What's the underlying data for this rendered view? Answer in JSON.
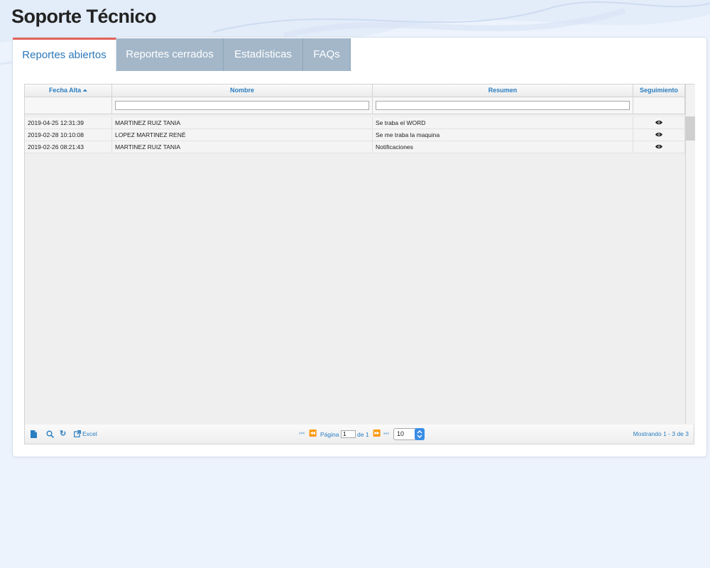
{
  "page": {
    "title": "Soporte Técnico"
  },
  "tabs": [
    {
      "label": "Reportes abiertos",
      "active": true
    },
    {
      "label": "Reportes cerrados",
      "active": false
    },
    {
      "label": "Estadísticas",
      "active": false
    },
    {
      "label": "FAQs",
      "active": false
    }
  ],
  "grid": {
    "columns": {
      "fecha": "Fecha Alta",
      "nombre": "Nombre",
      "resumen": "Resumen",
      "seguimiento": "Seguimiento"
    },
    "filters": {
      "nombre": "",
      "resumen": ""
    },
    "rows": [
      {
        "fecha": "2019-04-25 12:31:39",
        "nombre": "MARTINEZ RUIZ TANIA",
        "resumen": "Se traba el WORD"
      },
      {
        "fecha": "2019-02-28 10:10:08",
        "nombre": "LOPEZ MARTINEZ RENÉ",
        "resumen": "Se me traba la maquina"
      },
      {
        "fecha": "2019-02-26 08:21:43",
        "nombre": "MARTINEZ RUIZ TANIA",
        "resumen": "Notificaciones"
      }
    ]
  },
  "pager": {
    "excel_label": "Excel",
    "page_label": "Página",
    "current_page": "1",
    "of_label": "de 1",
    "rows_per_page": "10",
    "summary": "Mostrando 1 - 3 de 3"
  },
  "colors": {
    "accent": "#2b78b9",
    "active_tab_border": "#e2625c",
    "inactive_tab": "#a3b7c9",
    "background": "#edf3fd"
  }
}
